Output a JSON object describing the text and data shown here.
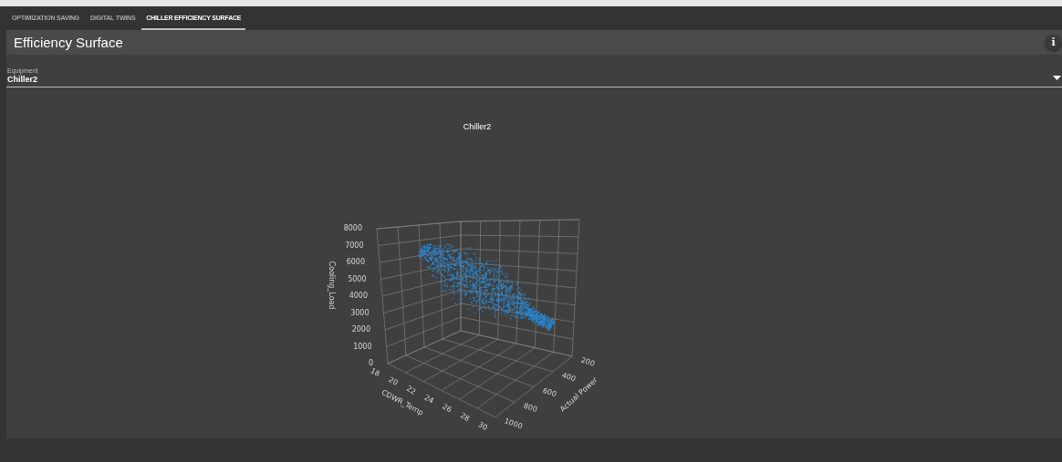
{
  "tabs": [
    {
      "label": "OPTIMIZATION SAVING",
      "selected": false
    },
    {
      "label": "DIGITAL TWINS",
      "selected": false
    },
    {
      "label": "CHILLER EFFICIENCY SURFACE",
      "selected": true
    }
  ],
  "header": {
    "title": "Efficiency Surface",
    "info_button": "i"
  },
  "equipment_field": {
    "label": "Equipment",
    "value": "Chiller2"
  },
  "chart": {
    "title": "Chiller2",
    "axes": [
      {
        "kind": "vertical",
        "title": "Cooling_Load",
        "ticks": [
          "8000",
          "7000",
          "6000",
          "5000",
          "4000",
          "3000",
          "2000",
          "1000",
          "0"
        ]
      },
      {
        "kind": "left",
        "title": "CDWR_Temp",
        "ticks": [
          "18",
          "20",
          "22",
          "24",
          "26",
          "28",
          "30"
        ]
      },
      {
        "kind": "right",
        "title": "Actual Power",
        "ticks": [
          "1000",
          "800",
          "600",
          "400",
          "200"
        ]
      }
    ]
  }
}
